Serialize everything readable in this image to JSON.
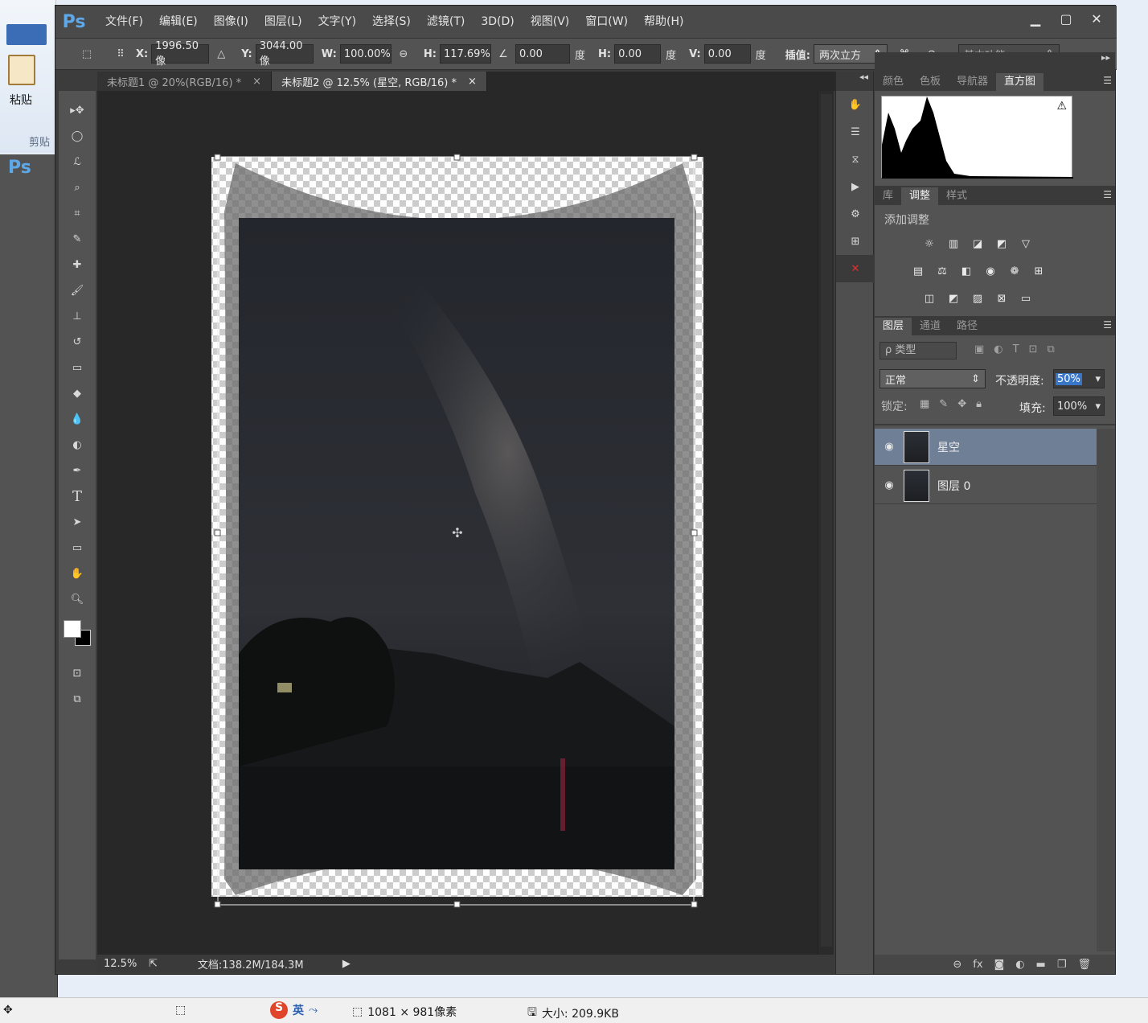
{
  "app": {
    "logo": "Ps"
  },
  "menu": [
    "文件(F)",
    "编辑(E)",
    "图像(I)",
    "图层(L)",
    "文字(Y)",
    "选择(S)",
    "滤镜(T)",
    "3D(D)",
    "视图(V)",
    "窗口(W)",
    "帮助(H)"
  ],
  "options": {
    "x_label": "X:",
    "x_value": "1996.50 像",
    "y_label": "Y:",
    "y_value": "3044.00 像",
    "w_label": "W:",
    "w_value": "100.00%",
    "h_label": "H:",
    "h_value": "117.69%",
    "angle_value": "0.00",
    "deg": "度",
    "hskew_label": "H:",
    "hskew_value": "0.00",
    "vskew_label": "V:",
    "vskew_value": "0.00",
    "interp_label": "插值:",
    "interp_value": "两次立方",
    "workspace": "基本功能"
  },
  "tabs": [
    {
      "label": "未标题1 @ 20%(RGB/16) *",
      "close": "×"
    },
    {
      "label": "未标题2 @ 12.5% (星空, RGB/16) *",
      "close": "×"
    }
  ],
  "status": {
    "zoom": "12.5%",
    "doc": "文档:138.2M/184.3M"
  },
  "panel_tabs_top": [
    "颜色",
    "色板",
    "导航器",
    "直方图"
  ],
  "panel_tabs_mid": [
    "库",
    "调整",
    "样式"
  ],
  "adjust_title": "添加调整",
  "panel_tabs_layers": [
    "图层",
    "通道",
    "路径"
  ],
  "layers": {
    "filter": "ρ 类型",
    "blend": "正常",
    "opacity_label": "不透明度:",
    "opacity_value": "50%",
    "lock_label": "锁定:",
    "fill_label": "填充:",
    "fill_value": "100%",
    "items": [
      {
        "name": "星空",
        "selected": true
      },
      {
        "name": "图层 0",
        "selected": false
      }
    ]
  },
  "bg_paint": {
    "paste": "粘贴",
    "clipboard": "剪贴",
    "pixels": "1081 × 981像素",
    "size": "大小: 209.9KB",
    "ime": "英"
  }
}
